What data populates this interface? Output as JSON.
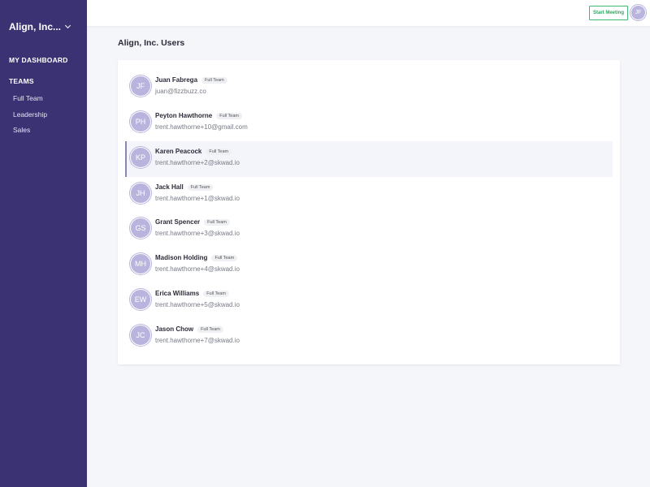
{
  "sidebar": {
    "org_name": "Align, Inc...",
    "dashboard_label": "MY DASHBOARD",
    "teams_label": "TEAMS",
    "teams": [
      {
        "label": "Full Team"
      },
      {
        "label": "Leadership"
      },
      {
        "label": "Sales"
      }
    ],
    "background": "#3b3273"
  },
  "topbar": {
    "start_meeting_label": "Start Meeting",
    "avatar_initials": "JF",
    "accent": "#3dbb75"
  },
  "main": {
    "title": "Align, Inc. Users",
    "users": [
      {
        "initials": "JF",
        "name": "Juan Fabrega",
        "tag": "Full Team",
        "email": "juan@fizzbuzz.co"
      },
      {
        "initials": "PH",
        "name": "Peyton Hawthorne",
        "tag": "Full Team",
        "email": "trent.hawthorne+10@gmail.com"
      },
      {
        "initials": "KP",
        "name": "Karen Peacock",
        "tag": "Full Team",
        "email": "trent.hawthorne+2@skwad.io",
        "selected": true
      },
      {
        "initials": "JH",
        "name": "Jack Hall",
        "tag": "Full Team",
        "email": "trent.hawthorne+1@skwad.io"
      },
      {
        "initials": "GS",
        "name": "Grant Spencer",
        "tag": "Full Team",
        "email": "trent.hawthorne+3@skwad.io"
      },
      {
        "initials": "MH",
        "name": "Madison Holding",
        "tag": "Full Team",
        "email": "trent.hawthorne+4@skwad.io"
      },
      {
        "initials": "EW",
        "name": "Erica Williams",
        "tag": "Full Team",
        "email": "trent.hawthorne+5@skwad.io"
      },
      {
        "initials": "JC",
        "name": "Jason Chow",
        "tag": "Full Team",
        "email": "trent.hawthorne+7@skwad.io"
      }
    ],
    "avatar_color": "#b9b4dd"
  }
}
